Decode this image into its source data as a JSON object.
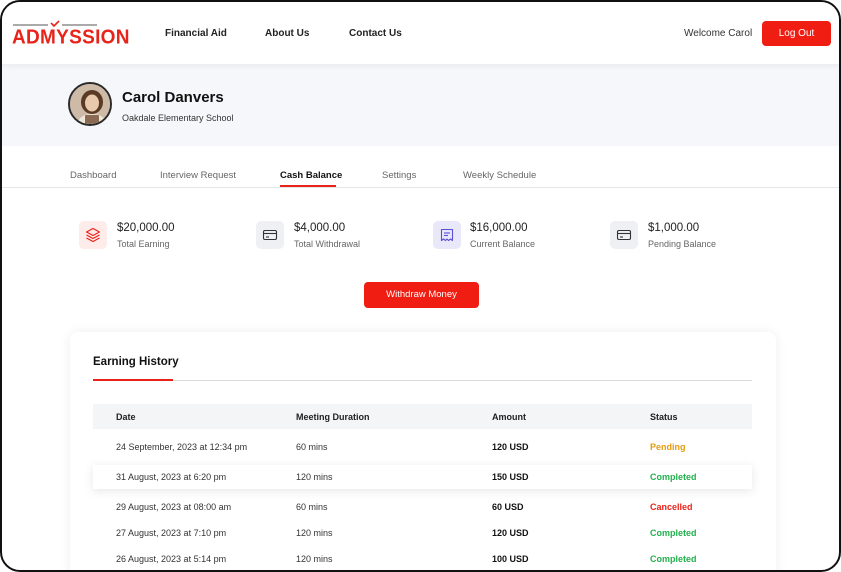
{
  "header": {
    "logo_text": "ADMYSSION",
    "nav": [
      {
        "label": "Financial Aid"
      },
      {
        "label": "About Us"
      },
      {
        "label": "Contact Us"
      }
    ],
    "welcome_text": "Welcome Carol",
    "logout_label": "Log Out"
  },
  "profile": {
    "name": "Carol Danvers",
    "school": "Oakdale Elementary School"
  },
  "tabs": [
    {
      "label": "Dashboard",
      "active": false
    },
    {
      "label": "Interview Request",
      "active": false
    },
    {
      "label": "Cash Balance",
      "active": true
    },
    {
      "label": "Settings",
      "active": false
    },
    {
      "label": "Weekly Schedule",
      "active": false
    }
  ],
  "stats": [
    {
      "value": "$20,000.00",
      "label": "Total Earning",
      "icon": "layers-icon"
    },
    {
      "value": "$4,000.00",
      "label": "Total Withdrawal",
      "icon": "card-icon"
    },
    {
      "value": "$16,000.00",
      "label": "Current Balance",
      "icon": "receipt-icon"
    },
    {
      "value": "$1,000.00",
      "label": "Pending Balance",
      "icon": "card-icon"
    }
  ],
  "withdraw_label": "Withdraw Money",
  "earning_history": {
    "title": "Earning History",
    "columns": [
      "Date",
      "Meeting Duration",
      "Amount",
      "Status"
    ],
    "rows": [
      {
        "date": "24 September, 2023 at 12:34 pm",
        "duration": "60 mins",
        "amount": "120 USD",
        "status": "Pending"
      },
      {
        "date": "31 August, 2023 at 6:20 pm",
        "duration": "120 mins",
        "amount": "150 USD",
        "status": "Completed"
      },
      {
        "date": "29 August, 2023 at 08:00 am",
        "duration": "60 mins",
        "amount": "60 USD",
        "status": "Cancelled"
      },
      {
        "date": "27 August, 2023 at 7:10 pm",
        "duration": "120 mins",
        "amount": "120 USD",
        "status": "Completed"
      },
      {
        "date": "26 August, 2023 at 5:14 pm",
        "duration": "120 mins",
        "amount": "100 USD",
        "status": "Completed"
      }
    ]
  },
  "colors": {
    "accent": "#f01d12",
    "pending": "#e69b0e",
    "completed": "#22b14c",
    "cancelled": "#e8231a"
  }
}
